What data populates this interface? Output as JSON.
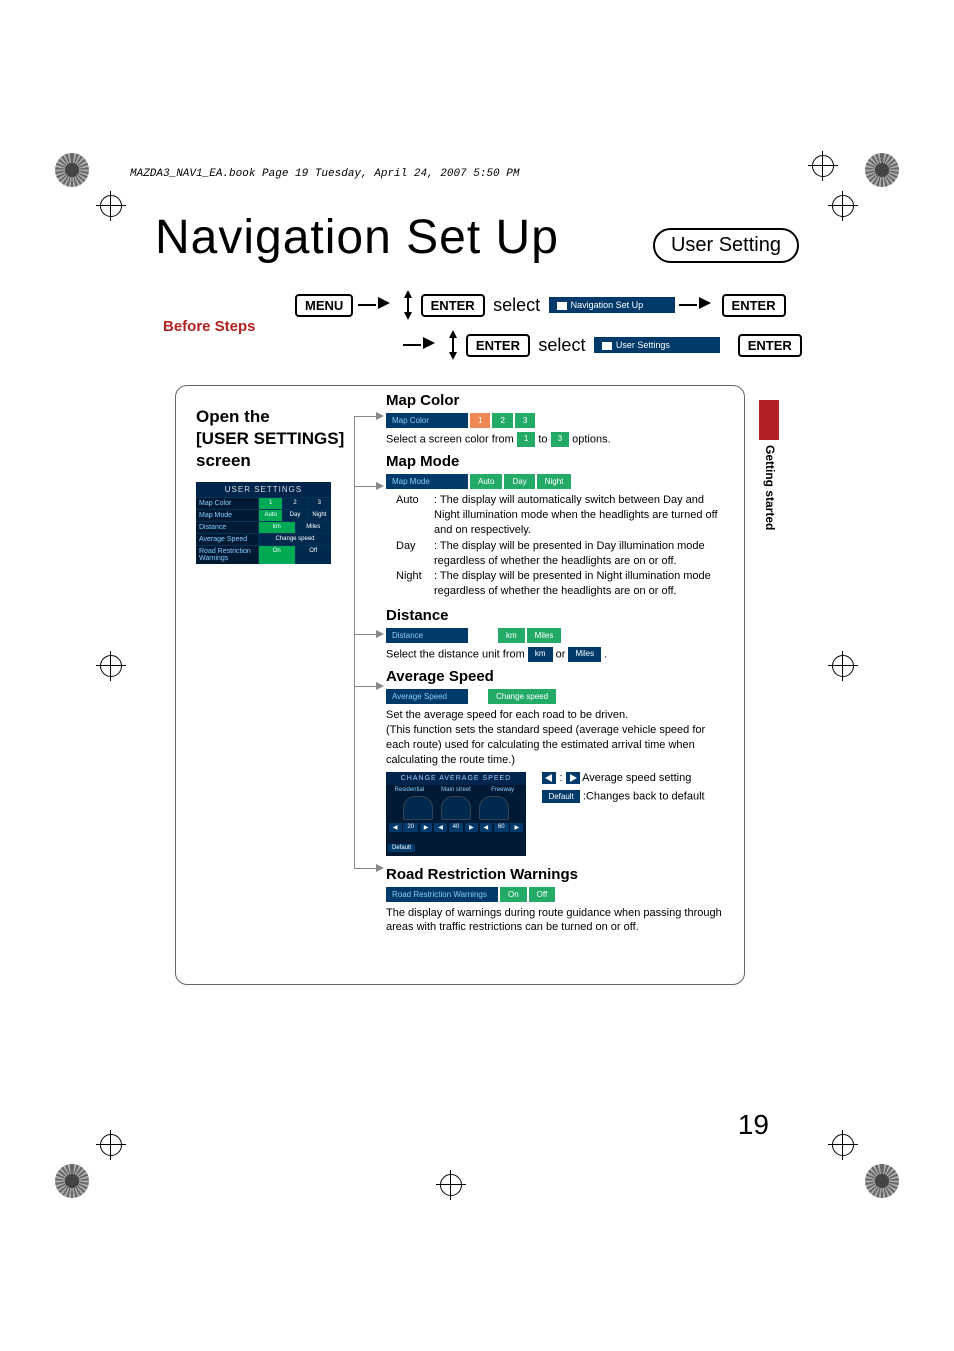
{
  "header_line": "MAZDA3_NAV1_EA.book  Page 19  Tuesday, April 24, 2007  5:50 PM",
  "title": "Navigation Set Up",
  "subtitle": "User Setting",
  "before_steps_label": "Before Steps",
  "buttons": {
    "menu": "MENU",
    "enter": "ENTER"
  },
  "select_word": "select",
  "nav_chip1": "Navigation Set Up",
  "nav_chip2": "User Settings",
  "open_title_l1": "Open the",
  "open_title_l2": "[USER SETTINGS]",
  "open_title_l3": "screen",
  "user_settings_shot": {
    "header": "USER SETTINGS",
    "rows": [
      {
        "label": "Map Color",
        "opts": [
          "1",
          "2",
          "3"
        ]
      },
      {
        "label": "Map Mode",
        "opts": [
          "Auto",
          "Day",
          "Night"
        ]
      },
      {
        "label": "Distance",
        "opts": [
          "km",
          "Miles"
        ]
      },
      {
        "label": "Average Speed",
        "opts": [
          "Change speed"
        ]
      },
      {
        "label": "Road Restriction Warnings",
        "opts": [
          "On",
          "Off"
        ]
      }
    ]
  },
  "sections": {
    "map_color": {
      "h": "Map Color",
      "chip_label": "Map Color",
      "chip_opts": [
        "1",
        "2",
        "3"
      ],
      "body_pre": "Select a screen color from ",
      "body_mid": " to ",
      "body_post": " options.",
      "from": "1",
      "to": "3"
    },
    "map_mode": {
      "h": "Map Mode",
      "chip_label": "Map Mode",
      "chip_opts": [
        "Auto",
        "Day",
        "Night"
      ],
      "auto_k": "Auto",
      "auto_v": ": The display will automatically switch between Day and Night illumination mode when the headlights are turned off and on respectively.",
      "day_k": "Day",
      "day_v": ": The display will be presented in Day illumination mode regardless of whether the headlights are on or off.",
      "night_k": "Night",
      "night_v": ": The display will be presented in Night illumination mode regardless of whether the headlights are on or off."
    },
    "distance": {
      "h": "Distance",
      "chip_label": "Distance",
      "chip_opts": [
        "km",
        "Miles"
      ],
      "body_pre": "Select the distance unit from ",
      "body_mid": " or ",
      "body_post": ".",
      "opt1": "km",
      "opt2": "Miles"
    },
    "avg": {
      "h": "Average Speed",
      "chip_label": "Average Speed",
      "chip_btn": "Change speed",
      "body": "Set the average speed for each road to be driven.\n(This function sets the standard speed (average vehicle speed for each route) used for calculating the estimated arrival time when calculating the route time.)",
      "shot_header": "CHANGE AVERAGE SPEED",
      "cols": [
        "Residential",
        "Main street",
        "Freeway"
      ],
      "default_btn": "Default",
      "side1": " Average speed setting",
      "side2": ":Changes back to default",
      "side2_chip": "Default"
    },
    "rrw": {
      "h": "Road Restriction Warnings",
      "chip_label": "Road Restriction Warnings",
      "chip_opts": [
        "On",
        "Off"
      ],
      "body": "The display of warnings during route guidance when passing through areas with traffic restrictions can be turned on or off."
    }
  },
  "side_tab": "Getting started",
  "page_number": "19"
}
